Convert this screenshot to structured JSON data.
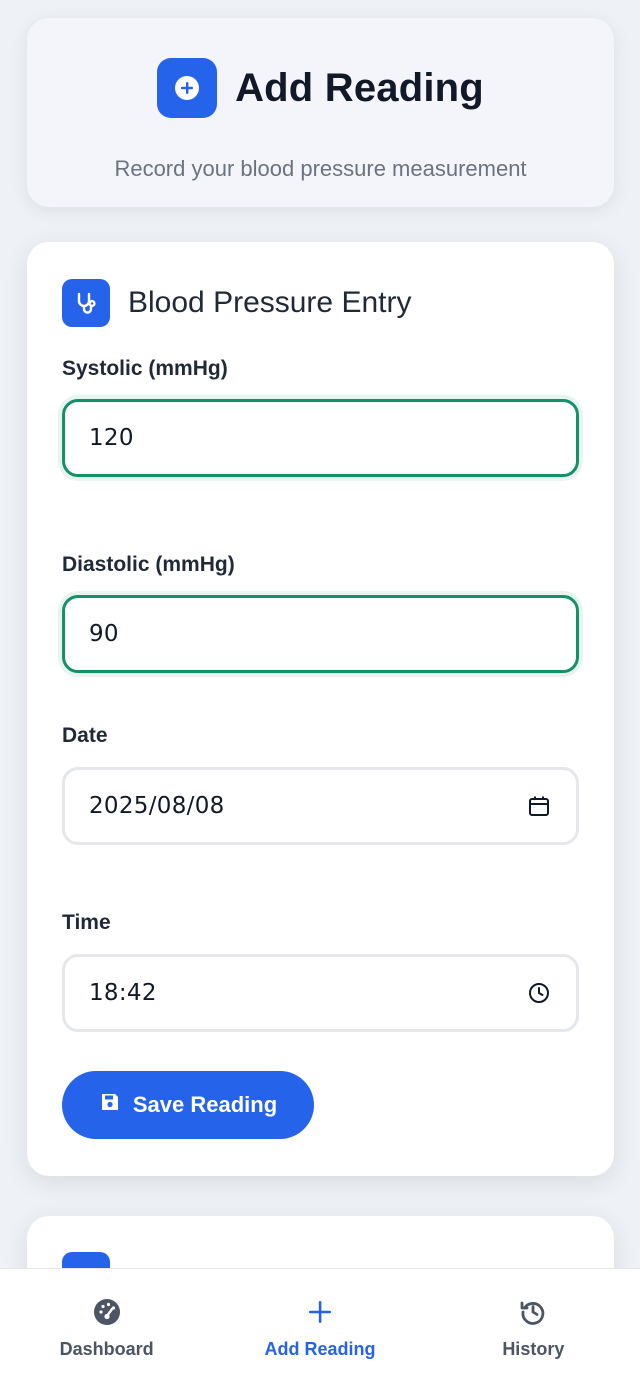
{
  "header": {
    "title": "Add Reading",
    "subtitle": "Record your blood pressure measurement",
    "icon": "plus-circle-icon"
  },
  "form": {
    "title": "Blood Pressure Entry",
    "icon": "stethoscope-icon",
    "systolic": {
      "label": "Systolic (mmHg)",
      "value": "120"
    },
    "diastolic": {
      "label": "Diastolic (mmHg)",
      "value": "90"
    },
    "date": {
      "label": "Date",
      "value": "2025/08/08",
      "icon": "calendar-icon"
    },
    "time": {
      "label": "Time",
      "value": "18:42",
      "icon": "clock-icon"
    },
    "save_label": "Save Reading",
    "save_icon": "floppy-disk-icon"
  },
  "nav": {
    "items": [
      {
        "label": "Dashboard",
        "icon": "gauge-icon",
        "active": false
      },
      {
        "label": "Add Reading",
        "icon": "plus-icon",
        "active": true
      },
      {
        "label": "History",
        "icon": "history-icon",
        "active": false
      }
    ]
  },
  "colors": {
    "accent": "#2563eb",
    "valid_border": "#159067",
    "text": "#1f2937",
    "muted": "#6b7280"
  }
}
